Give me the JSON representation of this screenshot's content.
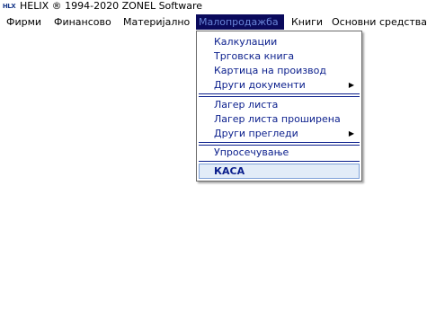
{
  "titlebar": {
    "icon_text": "HLX",
    "title": "HELIX ® 1994-2020   ZONEL Software"
  },
  "menubar": {
    "items": [
      {
        "label": "Фирми"
      },
      {
        "label": "Финансово"
      },
      {
        "label": "Материјално"
      },
      {
        "label": "Малопродажба",
        "active": true
      },
      {
        "label": "Книги"
      },
      {
        "label": "Основни средства"
      }
    ]
  },
  "dropdown": {
    "items": [
      {
        "label": "Калкулации"
      },
      {
        "label": "Трговска книга"
      },
      {
        "label": "Картица на производ"
      },
      {
        "label": "Други документи",
        "submenu": true
      },
      {
        "label": "Лагер листа"
      },
      {
        "label": "Лагер листа проширена"
      },
      {
        "label": "Други прегледи",
        "submenu": true
      },
      {
        "label": "Упросечување"
      },
      {
        "label": "КАСА"
      }
    ],
    "submenu_arrow": "▶"
  }
}
